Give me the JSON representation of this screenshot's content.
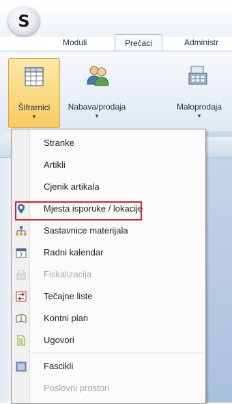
{
  "app": {
    "orb_letter": "S"
  },
  "tabs": [
    {
      "label": "Moduli"
    },
    {
      "label": "Prečaci"
    },
    {
      "label": "Administr"
    }
  ],
  "ribbon": [
    {
      "label": "Šifrarnici",
      "icon": "grid-icon"
    },
    {
      "label": "Nabava/prodaja",
      "icon": "people-icon"
    },
    {
      "label": "Maloprodaja",
      "icon": "cash-register-icon"
    }
  ],
  "menu": {
    "items": [
      {
        "label": "Stranke",
        "icon": "",
        "disabled": false
      },
      {
        "label": "Artikli",
        "icon": "",
        "disabled": false
      },
      {
        "label": "Cjenik artikala",
        "icon": "",
        "disabled": false
      },
      {
        "label": "Mjesta isporuke / lokacije",
        "icon": "map-pin-icon",
        "disabled": false
      },
      {
        "label": "Sastavnice materijala",
        "icon": "hierarchy-icon",
        "disabled": false
      },
      {
        "label": "Radni kalendar",
        "icon": "calendar-icon",
        "disabled": false
      },
      {
        "label": "Fiskalizacija",
        "icon": "fiscal-icon",
        "disabled": true
      },
      {
        "label": "Tečajne liste",
        "icon": "exchange-icon",
        "disabled": false
      },
      {
        "label": "Kontni plan",
        "icon": "book-icon",
        "disabled": false,
        "highlighted": true
      },
      {
        "label": "Ugovori",
        "icon": "document-icon",
        "disabled": false
      },
      {
        "label": "Fascikli",
        "icon": "folder-icon",
        "disabled": false
      },
      {
        "label": "Poslovni prostori",
        "icon": "",
        "disabled": true
      }
    ]
  },
  "colors": {
    "highlight_border": "#d4202c",
    "active_button": "#f8cc62"
  }
}
